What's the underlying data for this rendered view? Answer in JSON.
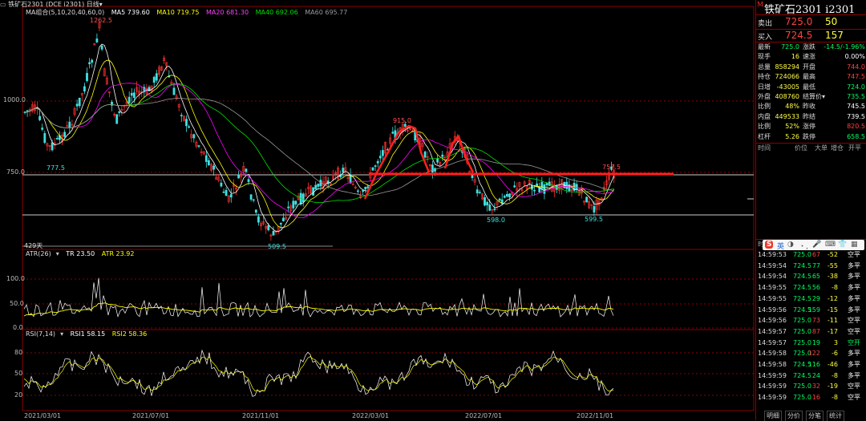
{
  "header": {
    "name": "铁矿石2301",
    "code": "(DCE i2301)",
    "period": "日线"
  },
  "ma_legend": {
    "title": "MA组合(5,10,20,40,60,0)",
    "items": [
      {
        "label": "MA5 739.60",
        "color": "#ffffff"
      },
      {
        "label": "MA10 719.75",
        "color": "#ffff00"
      },
      {
        "label": "MA20 681.30",
        "color": "#ff00ff"
      },
      {
        "label": "MA40 692.06",
        "color": "#00e000"
      },
      {
        "label": "MA60 695.77",
        "color": "#999999"
      }
    ]
  },
  "atr_legend": {
    "title": "ATR(26)",
    "items": [
      {
        "label": "TR 23.50",
        "color": "#ffffff"
      },
      {
        "label": "ATR 23.92",
        "color": "#ffff00"
      }
    ]
  },
  "rsi_legend": {
    "title": "RSI(7,14)",
    "items": [
      {
        "label": "RSI1 58.15",
        "color": "#ffffff"
      },
      {
        "label": "RSI2 58.36",
        "color": "#ffff00"
      }
    ]
  },
  "chart_data": [
    {
      "type": "candlestick",
      "title": "铁矿石2301",
      "x": [
        "2021/03/01",
        "2021/07/01",
        "2021/11/01",
        "2022/03/01",
        "2022/07/01",
        "2022/11/01"
      ],
      "y_ticks": [
        1000.0,
        750.0
      ],
      "annotations": [
        {
          "label": "1262.5"
        },
        {
          "label": "777.5"
        },
        {
          "label": "509.5"
        },
        {
          "label": "915.0"
        },
        {
          "label": "598.0"
        },
        {
          "label": "599.5"
        },
        {
          "label": "757.5"
        },
        {
          "label": "429天"
        }
      ]
    },
    {
      "type": "line",
      "title": "ATR(26)",
      "y_ticks": [
        100.0,
        50.0,
        0.0
      ]
    },
    {
      "type": "line",
      "title": "RSI(7,14)",
      "y_ticks": [
        80,
        50,
        20
      ]
    }
  ],
  "x_axis": [
    {
      "label": "2021/03/01"
    },
    {
      "label": "2021/07/01"
    },
    {
      "label": "2021/11/01"
    },
    {
      "label": "2022/03/01"
    },
    {
      "label": "2022/07/01"
    },
    {
      "label": "2022/11/01"
    }
  ],
  "y_main": [
    "1000.0",
    "750.0"
  ],
  "y_atr": [
    "100.0",
    "50.0",
    "0.0"
  ],
  "y_rsi": [
    "80",
    "50",
    "20"
  ],
  "price_labels": {
    "high": "1262.5",
    "low1": "777.5",
    "low2": "509.5",
    "peak": "915.0",
    "low3": "598.0",
    "low4": "599.5",
    "last": "757.5",
    "days": "429天"
  },
  "side": {
    "m_badge": "M",
    "title": "铁矿石2301  i2301",
    "sell": {
      "label": "卖出",
      "price": "725.0",
      "vol": "50"
    },
    "buy": {
      "label": "买入",
      "price": "724.5",
      "vol": "157"
    },
    "quotes": [
      {
        "k1": "最新",
        "v1": "725.0",
        "c1": "#00ff60",
        "k2": "涨跌",
        "v2": "-14.5/-1.96%",
        "c2": "#00ff60"
      },
      {
        "k1": "现手",
        "v1": "16",
        "c1": "#ffff40",
        "k2": "速涨",
        "v2": "0.00%",
        "c2": "#ffffff"
      },
      {
        "k1": "总量",
        "v1": "858294",
        "c1": "#ffff40",
        "k2": "开盘",
        "v2": "744.0",
        "c2": "#ff4040"
      },
      {
        "k1": "持仓",
        "v1": "724066",
        "c1": "#ffff40",
        "k2": "最高",
        "v2": "747.5",
        "c2": "#ff4040"
      },
      {
        "k1": "日增",
        "v1": "-43005",
        "c1": "#ffff40",
        "k2": "最低",
        "v2": "724.0",
        "c2": "#00ff60"
      },
      {
        "k1": "外盘",
        "v1": "408760",
        "c1": "#ffff40",
        "k2": "结算价▾",
        "v2": "735.5",
        "c2": "#00ff60"
      },
      {
        "k1": "比例",
        "v1": "48%",
        "c1": "#ffff40",
        "k2": "昨收",
        "v2": "745.5",
        "c2": "#ffffff"
      },
      {
        "k1": "内盘",
        "v1": "449533",
        "c1": "#ffff40",
        "k2": "昨结",
        "v2": "739.5",
        "c2": "#ffffff"
      },
      {
        "k1": "比例",
        "v1": "52%",
        "c1": "#ffff40",
        "k2": "涨停",
        "v2": "820.5",
        "c2": "#ff4040"
      },
      {
        "k1": "杠杆",
        "v1": "5.26",
        "c1": "#ffff40",
        "k2": "跌停",
        "v2": "658.5",
        "c2": "#00ff60"
      }
    ],
    "tick_header": {
      "t": "时间",
      "p": "价位",
      "v": "大单",
      "c": "增仓",
      "s": "开平"
    },
    "time_header": "时间",
    "ticks": [
      {
        "t": "14:59:53",
        "p": "725.0",
        "v": "67",
        "c": "-52",
        "s": "空平",
        "pc": "#00ff60",
        "vc": "#ff4040",
        "sc": "#ffffff"
      },
      {
        "t": "14:59:54",
        "p": "724.5",
        "v": "77",
        "c": "-55",
        "s": "多平",
        "pc": "#00ff60",
        "vc": "#00ff60",
        "sc": "#ffffff"
      },
      {
        "t": "14:59:54",
        "p": "724.5",
        "v": "65",
        "c": "-38",
        "s": "多平",
        "pc": "#00ff60",
        "vc": "#00ff60",
        "sc": "#ffffff"
      },
      {
        "t": "14:59:55",
        "p": "724.5",
        "v": "56",
        "c": "-8",
        "s": "多平",
        "pc": "#00ff60",
        "vc": "#00ff60",
        "sc": "#ffffff"
      },
      {
        "t": "14:59:55",
        "p": "724.5",
        "v": "29",
        "c": "-12",
        "s": "多平",
        "pc": "#00ff60",
        "vc": "#00ff60",
        "sc": "#ffffff"
      },
      {
        "t": "14:59:56",
        "p": "724.5",
        "v": "159",
        "c": "-15",
        "s": "多平",
        "pc": "#00ff60",
        "vc": "#00ff60",
        "sc": "#ffffff"
      },
      {
        "t": "14:59:56",
        "p": "725.0",
        "v": "73",
        "c": "-11",
        "s": "空平",
        "pc": "#00ff60",
        "vc": "#ff4040",
        "sc": "#ffffff"
      },
      {
        "t": "14:59:57",
        "p": "725.0",
        "v": "87",
        "c": "-17",
        "s": "空平",
        "pc": "#00ff60",
        "vc": "#ff4040",
        "sc": "#ffffff"
      },
      {
        "t": "14:59:57",
        "p": "725.0",
        "v": "19",
        "c": "3",
        "s": "空开",
        "pc": "#00ff60",
        "vc": "#00ff60",
        "sc": "#00ff60"
      },
      {
        "t": "14:59:58",
        "p": "725.0",
        "v": "122",
        "c": "-6",
        "s": "多平",
        "pc": "#00ff60",
        "vc": "#ff4040",
        "sc": "#ffffff"
      },
      {
        "t": "14:59:58",
        "p": "724.5",
        "v": "116",
        "c": "-46",
        "s": "多平",
        "pc": "#00ff60",
        "vc": "#00ff60",
        "sc": "#ffffff"
      },
      {
        "t": "14:59:59",
        "p": "724.5",
        "v": "24",
        "c": "-8",
        "s": "多平",
        "pc": "#00ff60",
        "vc": "#00ff60",
        "sc": "#ffffff"
      },
      {
        "t": "14:59:59",
        "p": "725.0",
        "v": "32",
        "c": "-19",
        "s": "空平",
        "pc": "#00ff60",
        "vc": "#ff4040",
        "sc": "#ffffff"
      },
      {
        "t": "14:59:59",
        "p": "725.0",
        "v": "16",
        "c": "-8",
        "s": "空平",
        "pc": "#00ff60",
        "vc": "#ff4040",
        "sc": "#ffffff"
      }
    ],
    "tabs": [
      "明细",
      "分价",
      "分笔",
      "统计"
    ]
  },
  "ime": {
    "logo": "S",
    "lang": "英"
  }
}
